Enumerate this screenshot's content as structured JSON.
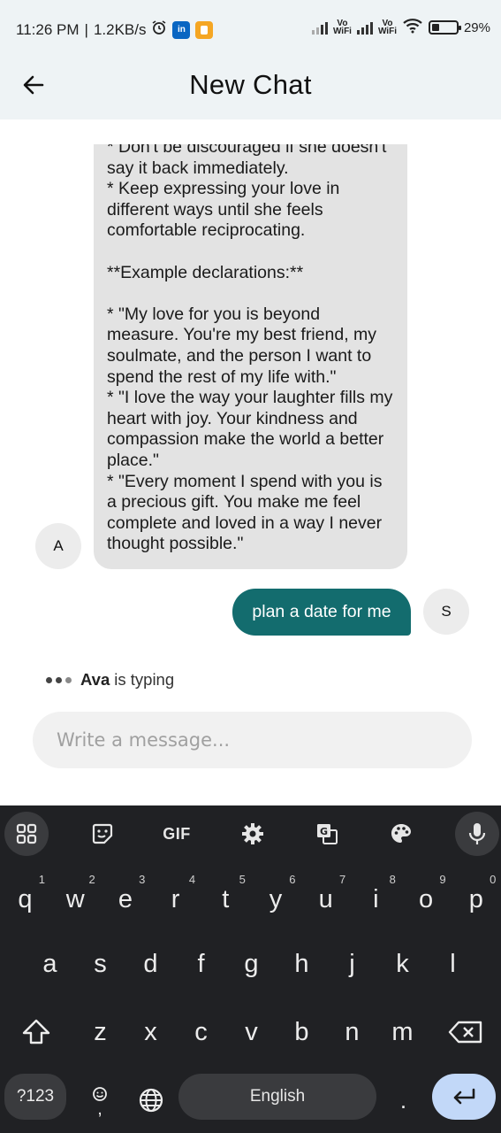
{
  "status_bar": {
    "time": "11:26 PM",
    "separator": "|",
    "speed": "1.2KB/s",
    "vo1_top": "Vo",
    "vo1_bottom": "WiFi",
    "vo2_top": "Vo",
    "vo2_bottom": "WiFi",
    "battery": "29%",
    "app_icon_linkedin": "in"
  },
  "header": {
    "title": "New Chat",
    "back_icon": "arrow-left-icon"
  },
  "chat": {
    "bot_message": "* Don't be discouraged if she doesn't say it back immediately.\n* Keep expressing your love in different ways until she feels comfortable reciprocating.\n\n**Example declarations:**\n\n* \"My love for you is beyond measure. You're my best friend, my soulmate, and the person I want to spend the rest of my life with.\"\n* \"I love the way your laughter fills my heart with joy. Your kindness and compassion make the world a better place.\"\n* \"Every moment I spend with you is a precious gift. You make me feel complete and loved in a way I never thought possible.\"",
    "bot_avatar": "A",
    "user_message": "plan a date for me",
    "user_avatar": "S",
    "typing_name": "Ava",
    "typing_text": "is typing",
    "input_placeholder": "Write a message..."
  },
  "keyboard": {
    "toolbar_gif": "GIF",
    "row1": [
      {
        "key": "q",
        "num": "1"
      },
      {
        "key": "w",
        "num": "2"
      },
      {
        "key": "e",
        "num": "3"
      },
      {
        "key": "r",
        "num": "4"
      },
      {
        "key": "t",
        "num": "5"
      },
      {
        "key": "y",
        "num": "6"
      },
      {
        "key": "u",
        "num": "7"
      },
      {
        "key": "i",
        "num": "8"
      },
      {
        "key": "o",
        "num": "9"
      },
      {
        "key": "p",
        "num": "0"
      }
    ],
    "row2": [
      "a",
      "s",
      "d",
      "f",
      "g",
      "h",
      "j",
      "k",
      "l"
    ],
    "row3": [
      "z",
      "x",
      "c",
      "v",
      "b",
      "n",
      "m"
    ],
    "symbols_label": "?123",
    "space_label": "English",
    "period": ".",
    "comma": ","
  },
  "colors": {
    "header_bg": "#eef3f5",
    "user_bubble": "#136c6e",
    "bot_bubble": "#e3e3e3",
    "keyboard_bg": "#202124",
    "enter_key": "#c2d8f8"
  }
}
